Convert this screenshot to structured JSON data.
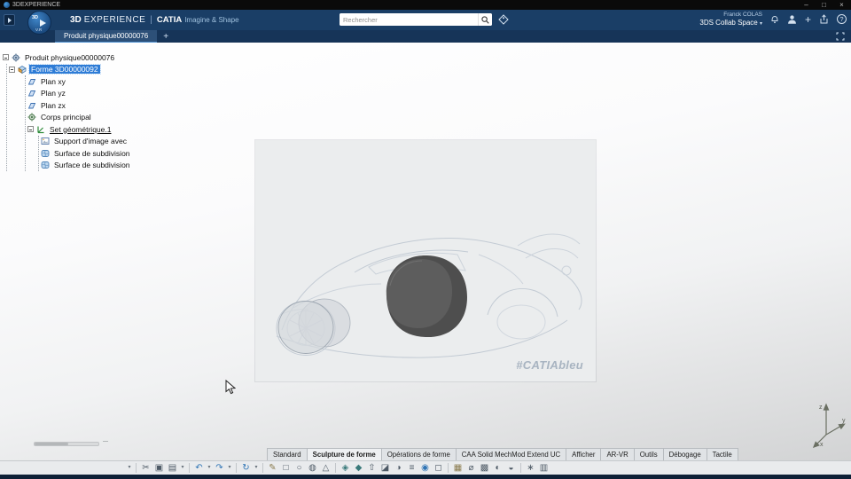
{
  "titlebar": {
    "app_title": "3DEXPERIENCE",
    "minimize": "–",
    "maximize": "□",
    "close": "×"
  },
  "header": {
    "brand_bold": "3D",
    "brand_light": "EXPERIENCE",
    "divider": "|",
    "app_name": "CATIA",
    "app_module": "Imagine & Shape",
    "logo_text_top": "3D",
    "logo_text_bottom": "V.R",
    "search_placeholder": "Rechercher",
    "user_name": "Franck COLAS",
    "workspace_name": "3DS Collab Space",
    "workspace_caret": "▾",
    "plus": "+",
    "help": "?"
  },
  "tabbar": {
    "active_tab_label": "Produit physique00000076",
    "new_tab_label": "+"
  },
  "tree": {
    "root_label": "Produit physique00000076",
    "nodes": [
      {
        "label": "Forme 3D00000092",
        "selected": true
      },
      {
        "label": "Plan xy"
      },
      {
        "label": "Plan yz"
      },
      {
        "label": "Plan zx"
      },
      {
        "label": "Corps principal"
      },
      {
        "label": "Set géométrique.1",
        "work_object": true
      },
      {
        "label": "Support d'image avec"
      },
      {
        "label": "Surface de subdivision"
      },
      {
        "label": "Surface de subdivision"
      }
    ]
  },
  "viewport": {
    "watermark": "#CATIAbleu",
    "axis_x": "x",
    "axis_y": "y",
    "axis_z": "z"
  },
  "ribbon": {
    "active_tab_index": 1,
    "tabs": [
      {
        "label": "Standard"
      },
      {
        "label": "Sculpture de forme"
      },
      {
        "label": "Opérations de forme"
      },
      {
        "label": "CAA Solid MechMod Extend UC"
      },
      {
        "label": "Afficher"
      },
      {
        "label": "AR-VR"
      },
      {
        "label": "Outils"
      },
      {
        "label": "Débogage"
      },
      {
        "label": "Tactile"
      }
    ],
    "tools": [
      {
        "name": "toolbar-overflow",
        "glyph": "▾"
      },
      {
        "name": "cut",
        "glyph": "✂"
      },
      {
        "name": "copy",
        "glyph": "▣"
      },
      {
        "name": "paste",
        "glyph": "▤"
      },
      {
        "name": "paste-options",
        "glyph": "▾"
      },
      {
        "name": "undo",
        "glyph": "↶"
      },
      {
        "name": "undo-options",
        "glyph": "▾"
      },
      {
        "name": "redo",
        "glyph": "↷"
      },
      {
        "name": "redo-options",
        "glyph": "▾"
      },
      {
        "name": "update",
        "glyph": "↻"
      },
      {
        "name": "update-options",
        "glyph": "▾"
      },
      {
        "name": "sketch",
        "glyph": "✎"
      },
      {
        "name": "box-primitive",
        "glyph": "□"
      },
      {
        "name": "sphere-primitive",
        "glyph": "○"
      },
      {
        "name": "cylinder-primitive",
        "glyph": "◍"
      },
      {
        "name": "pyramid-primitive",
        "glyph": "△"
      },
      {
        "name": "subdivision-surface",
        "glyph": "◈"
      },
      {
        "name": "modification",
        "glyph": "◆"
      },
      {
        "name": "extrusion",
        "glyph": "⇧"
      },
      {
        "name": "face-cut",
        "glyph": "◪"
      },
      {
        "name": "symmetry",
        "glyph": "◑"
      },
      {
        "name": "alignment",
        "glyph": "≡"
      },
      {
        "name": "attraction",
        "glyph": "◉"
      },
      {
        "name": "erase",
        "glyph": "◻"
      },
      {
        "name": "image-support",
        "glyph": "▦"
      },
      {
        "name": "measure",
        "glyph": "⌀"
      },
      {
        "name": "grid",
        "glyph": "▩"
      },
      {
        "name": "view-mode",
        "glyph": "◐"
      },
      {
        "name": "material",
        "glyph": "◒"
      },
      {
        "name": "settings",
        "glyph": "∗"
      },
      {
        "name": "catalog",
        "glyph": "▥"
      }
    ]
  },
  "icons": {
    "search": "magnifier",
    "tag": "diamond-tag",
    "bell": "bell",
    "avatar": "person",
    "add": "plus",
    "share": "arrow-from-box",
    "help": "question-circle",
    "fullscreen": "corner-brackets",
    "expand-node": "minus-box",
    "product": "gear",
    "shape": "3d-shape",
    "plane": "parallelogram",
    "body": "gear-body",
    "geometric-set": "axes",
    "image-support": "picture",
    "subdivision-surface": "mesh-square",
    "axis-triad": "xyz-arrows",
    "cursor": "arrow-pointer"
  },
  "colors": {
    "header_navy": "#1a3e66",
    "selection_blue": "#2e7cd6",
    "accent_blue": "#4d8fd0"
  }
}
